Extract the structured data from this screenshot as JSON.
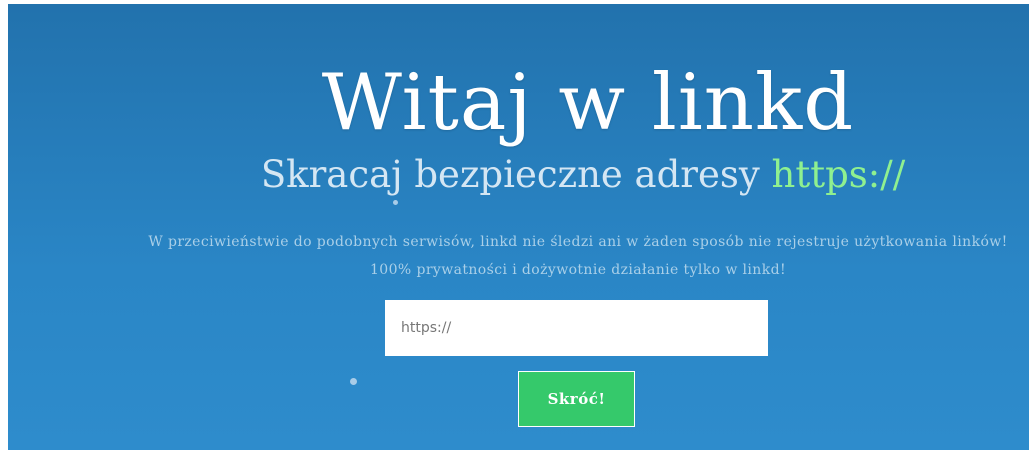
{
  "hero": {
    "title": "Witaj w linkd",
    "subtitle_prefix": "Skracaj bezpieczne adresy ",
    "subtitle_accent": "https://",
    "description": "W przeciwieństwie do podobnych serwisów, linkd nie śledzi ani w żaden sposób nie rejestruje użytkowania linków! 100% prywatności i dożywotnie działanie tylko w linkd!"
  },
  "form": {
    "url_placeholder": "https://",
    "submit_label": "Skróć!"
  },
  "colors": {
    "background": "#2a86c6",
    "accent_text": "#8ff090",
    "button": "#35c96b"
  }
}
